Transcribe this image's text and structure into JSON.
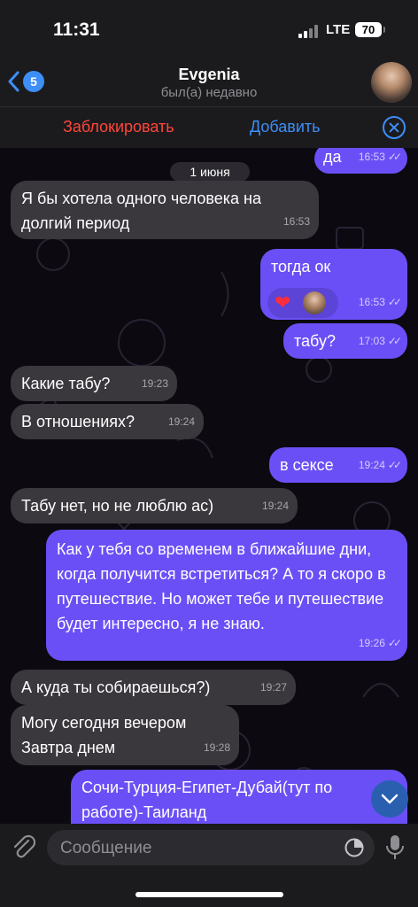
{
  "status_bar": {
    "time": "11:31",
    "network": "LTE",
    "battery": "70"
  },
  "header": {
    "back_count": "5",
    "contact_name": "Evgenia",
    "last_seen": "был(а) недавно"
  },
  "action_bar": {
    "block_label": "Заблокировать",
    "add_label": "Добавить"
  },
  "chat": {
    "date_separator": "1 июня",
    "messages": [
      {
        "dir": "out",
        "text": "да",
        "time": "16:53",
        "read": true
      },
      {
        "dir": "in",
        "text": "Я бы хотела одного человека на долгий период",
        "time": "16:53"
      },
      {
        "dir": "out",
        "text": "тогда ок",
        "time": "16:53",
        "read": true,
        "reactions": [
          "heart"
        ]
      },
      {
        "dir": "out",
        "text": "табу?",
        "time": "17:03",
        "read": true
      },
      {
        "dir": "in",
        "text": "Какие табу?",
        "time": "19:23"
      },
      {
        "dir": "in",
        "text": "В отношениях?",
        "time": "19:24"
      },
      {
        "dir": "out",
        "text": "в сексе",
        "time": "19:24",
        "read": true
      },
      {
        "dir": "in",
        "text": "Табу нет, но не люблю ас)",
        "time": "19:24"
      },
      {
        "dir": "out",
        "text": "Как у тебя со временем в ближайшие дни, когда получится встретиться? А то я скоро в путешествие. Но может тебе и путешествие будет интересно, я не знаю.",
        "time": "19:26",
        "read": true
      },
      {
        "dir": "in",
        "text": "А куда ты собираешься?)",
        "time": "19:27"
      },
      {
        "dir": "in",
        "text": "Могу сегодня вечером Завтра днем",
        "time": "19:28"
      },
      {
        "dir": "out",
        "text": "Сочи-Турция-Египет-Дубай(тут по работе)-Таиланд",
        "time": "",
        "read": false
      }
    ]
  },
  "composer": {
    "placeholder": "Сообщение"
  },
  "colors": {
    "outgoing": "#6b4ff6",
    "incoming": "#3a373d",
    "accent": "#3e8ef7",
    "danger": "#ff453a"
  }
}
